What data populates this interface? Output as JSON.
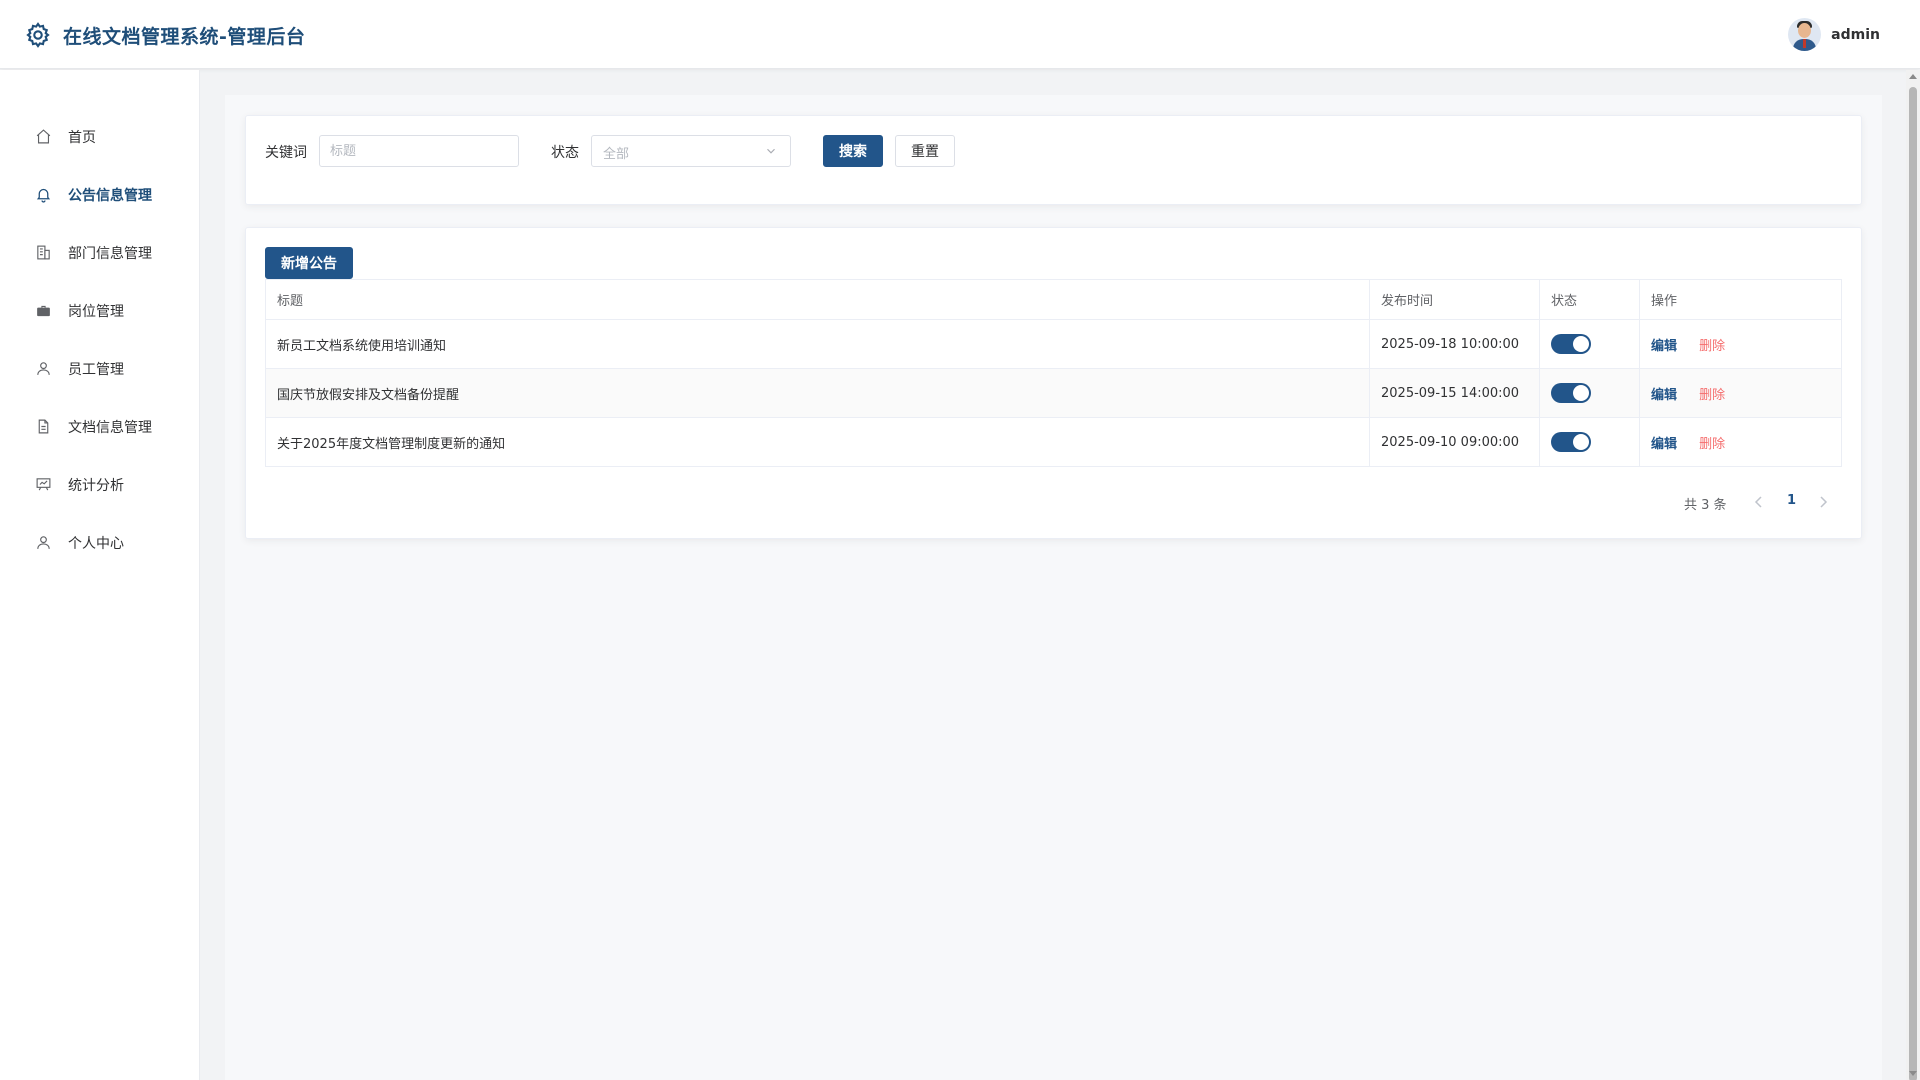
{
  "header": {
    "title": "在线文档管理系统-管理后台",
    "username": "admin"
  },
  "sidebar": {
    "items": [
      {
        "label": "首页",
        "icon": "home-icon",
        "active": false
      },
      {
        "label": "公告信息管理",
        "icon": "bell-icon",
        "active": true
      },
      {
        "label": "部门信息管理",
        "icon": "building-icon",
        "active": false
      },
      {
        "label": "岗位管理",
        "icon": "briefcase-icon",
        "active": false
      },
      {
        "label": "员工管理",
        "icon": "user-icon",
        "active": false
      },
      {
        "label": "文档信息管理",
        "icon": "document-icon",
        "active": false
      },
      {
        "label": "统计分析",
        "icon": "chart-icon",
        "active": false
      },
      {
        "label": "个人中心",
        "icon": "user-icon",
        "active": false
      }
    ]
  },
  "search": {
    "keyword_label": "关键词",
    "keyword_placeholder": "标题",
    "status_label": "状态",
    "status_value": "全部",
    "search_button": "搜索",
    "reset_button": "重置"
  },
  "list": {
    "add_button": "新增公告",
    "columns": [
      "标题",
      "发布时间",
      "状态",
      "操作"
    ],
    "rows": [
      {
        "title": "新员工文档系统使用培训通知",
        "time": "2025-09-18 10:00:00",
        "enabled": true
      },
      {
        "title": "国庆节放假安排及文档备份提醒",
        "time": "2025-09-15 14:00:00",
        "enabled": true
      },
      {
        "title": "关于2025年度文档管理制度更新的通知",
        "time": "2025-09-10 09:00:00",
        "enabled": true
      }
    ],
    "edit_label": "编辑",
    "delete_label": "删除"
  },
  "pagination": {
    "total_text": "共 3 条",
    "current_page": "1"
  },
  "colors": {
    "primary": "#22558a",
    "title": "#1f4e79",
    "danger": "#f56c6c"
  }
}
